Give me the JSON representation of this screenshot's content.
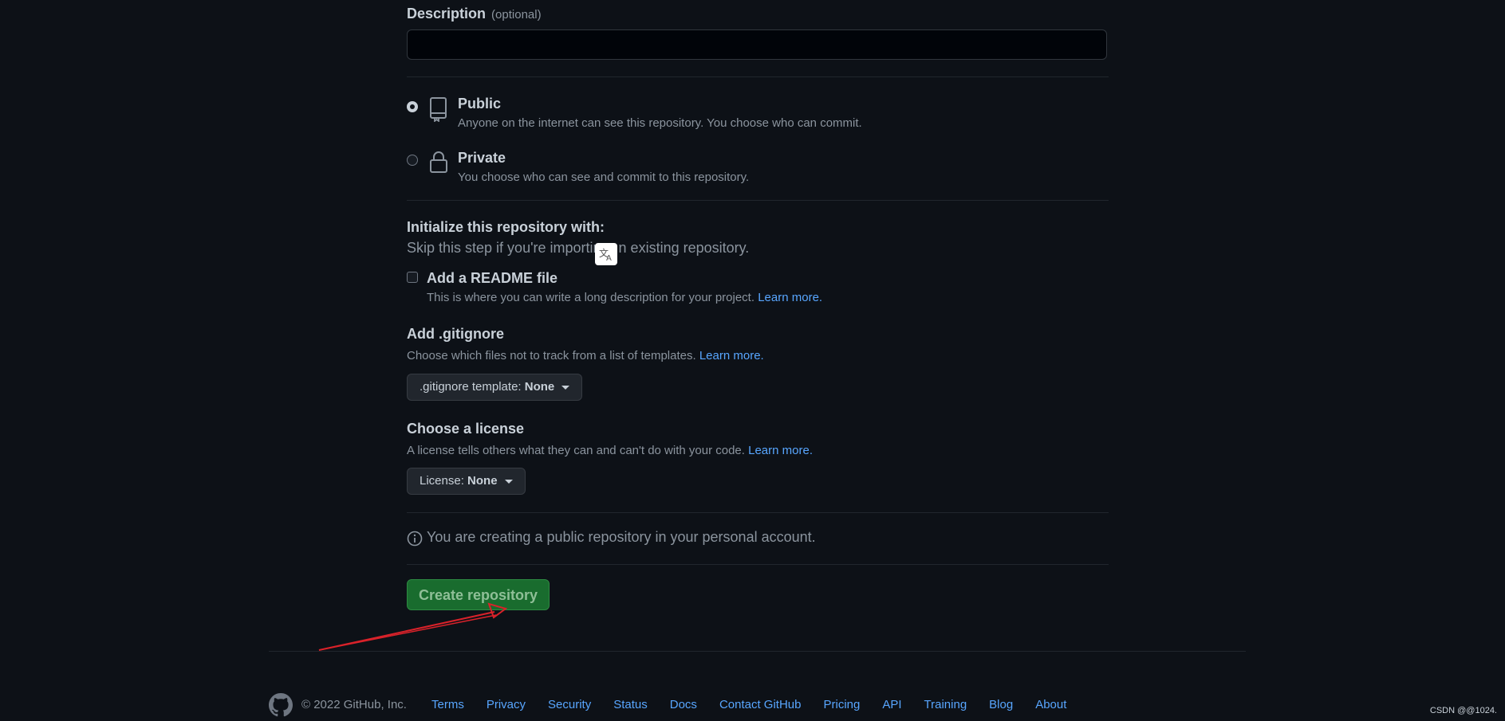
{
  "description": {
    "label": "Description",
    "optional": "(optional)",
    "value": ""
  },
  "visibility": {
    "options": [
      {
        "title": "Public",
        "desc": "Anyone on the internet can see this repository. You choose who can commit.",
        "checked": true,
        "icon": "repo-icon"
      },
      {
        "title": "Private",
        "desc": "You choose who can see and commit to this repository.",
        "checked": false,
        "icon": "lock-icon"
      }
    ]
  },
  "initialize": {
    "title": "Initialize this repository with:",
    "subtitle_before": "Skip this step if you're importin",
    "subtitle_after": "n existing repository.",
    "translate_icon": "translate-icon",
    "readme": {
      "title": "Add a README file",
      "desc": "This is where you can write a long description for your project.",
      "link": "Learn more."
    }
  },
  "gitignore": {
    "title": "Add .gitignore",
    "desc": "Choose which files not to track from a list of templates.",
    "link": "Learn more.",
    "select_prefix": ".gitignore template:",
    "select_value": "None"
  },
  "license": {
    "title": "Choose a license",
    "desc": "A license tells others what they can and can't do with your code.",
    "link": "Learn more.",
    "select_prefix": "License:",
    "select_value": "None"
  },
  "info": {
    "text": "You are creating a public repository in your personal account."
  },
  "create_button": "Create repository",
  "footer": {
    "copyright": "© 2022 GitHub, Inc.",
    "links": [
      "Terms",
      "Privacy",
      "Security",
      "Status",
      "Docs",
      "Contact GitHub",
      "Pricing",
      "API",
      "Training",
      "Blog",
      "About"
    ]
  },
  "watermark": "CSDN @@1024.",
  "colors": {
    "background": "#0d1117",
    "link": "#58a6ff",
    "button_green": "#196c2e",
    "annotation_arrow": "#d9222a"
  }
}
